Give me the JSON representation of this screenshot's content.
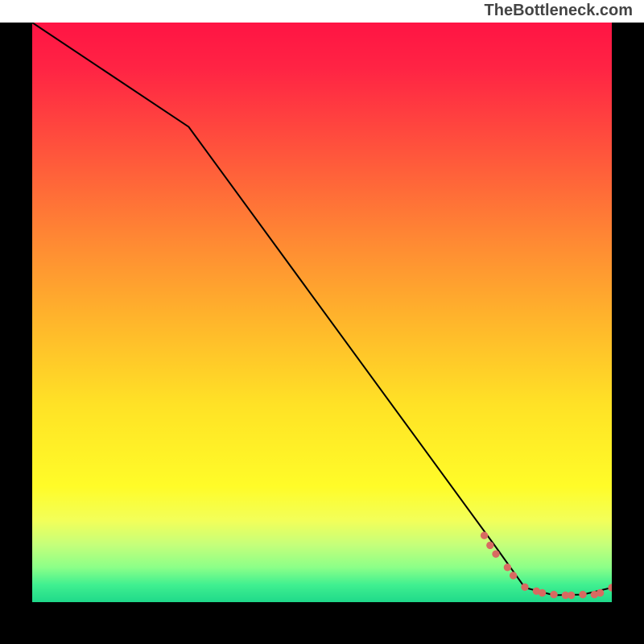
{
  "watermark": "TheBottleneck.com",
  "chart_data": {
    "type": "line",
    "title": "",
    "xlabel": "",
    "ylabel": "",
    "xlim": [
      0,
      100
    ],
    "ylim": [
      0,
      100
    ],
    "series": [
      {
        "name": "bottleneck-curve",
        "x": [
          0,
          27,
          80,
          85,
          90,
          95,
          100
        ],
        "values": [
          100,
          82,
          9.5,
          2.5,
          1.2,
          1.3,
          2.5
        ]
      }
    ],
    "markers": {
      "name": "data-points",
      "x": [
        78,
        79,
        80,
        82,
        83,
        85,
        87,
        88,
        90,
        92,
        93,
        95,
        97,
        98,
        100
      ],
      "values": [
        11.5,
        9.8,
        8.3,
        6.0,
        4.6,
        2.6,
        1.9,
        1.6,
        1.3,
        1.2,
        1.2,
        1.3,
        1.3,
        1.6,
        2.5
      ]
    }
  }
}
